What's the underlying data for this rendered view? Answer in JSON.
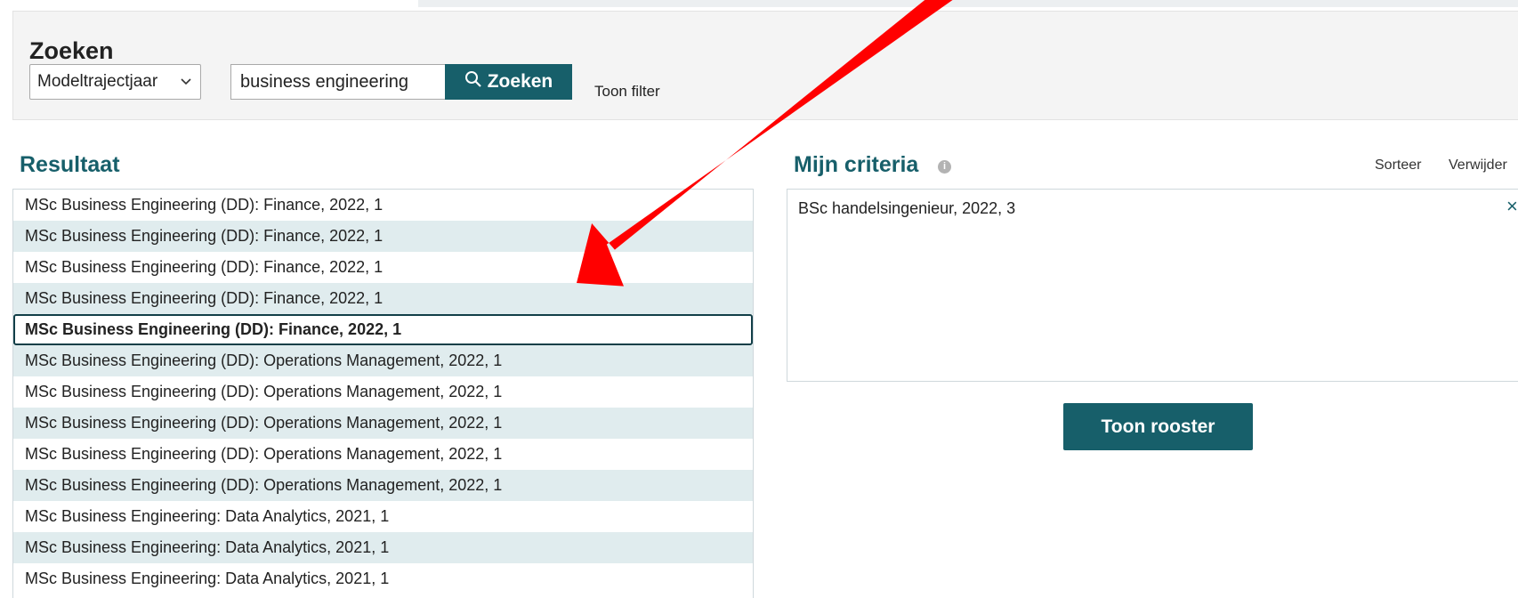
{
  "search": {
    "title": "Zoeken",
    "type_select": "Modeltrajectjaar",
    "query": "business engineering",
    "button_label": "Zoeken",
    "filter_link": "Toon filter"
  },
  "results": {
    "title": "Resultaat",
    "rows": [
      "MSc Business Engineering (DD): Finance, 2022, 1",
      "MSc Business Engineering (DD): Finance, 2022, 1",
      "MSc Business Engineering (DD): Finance, 2022, 1",
      "MSc Business Engineering (DD): Finance, 2022, 1",
      "MSc Business Engineering (DD): Finance, 2022, 1",
      "MSc Business Engineering (DD): Operations Management, 2022, 1",
      "MSc Business Engineering (DD): Operations Management, 2022, 1",
      "MSc Business Engineering (DD): Operations Management, 2022, 1",
      "MSc Business Engineering (DD): Operations Management, 2022, 1",
      "MSc Business Engineering (DD): Operations Management, 2022, 1",
      "MSc Business Engineering: Data Analytics, 2021, 1",
      "MSc Business Engineering: Data Analytics, 2021, 1",
      "MSc Business Engineering: Data Analytics, 2021, 1"
    ]
  },
  "criteria": {
    "title": "Mijn criteria",
    "info_icon": "info-icon",
    "sort_link": "Sorteer",
    "remove_link": "Verwijder",
    "items": [
      "BSc handelsingenieur, 2022, 3"
    ],
    "remove_symbol": "×"
  },
  "show_button": "Toon rooster",
  "colors": {
    "accent": "#175f6a",
    "row_alt": "#e0ecee",
    "annotation_arrow": "#ff0000"
  }
}
